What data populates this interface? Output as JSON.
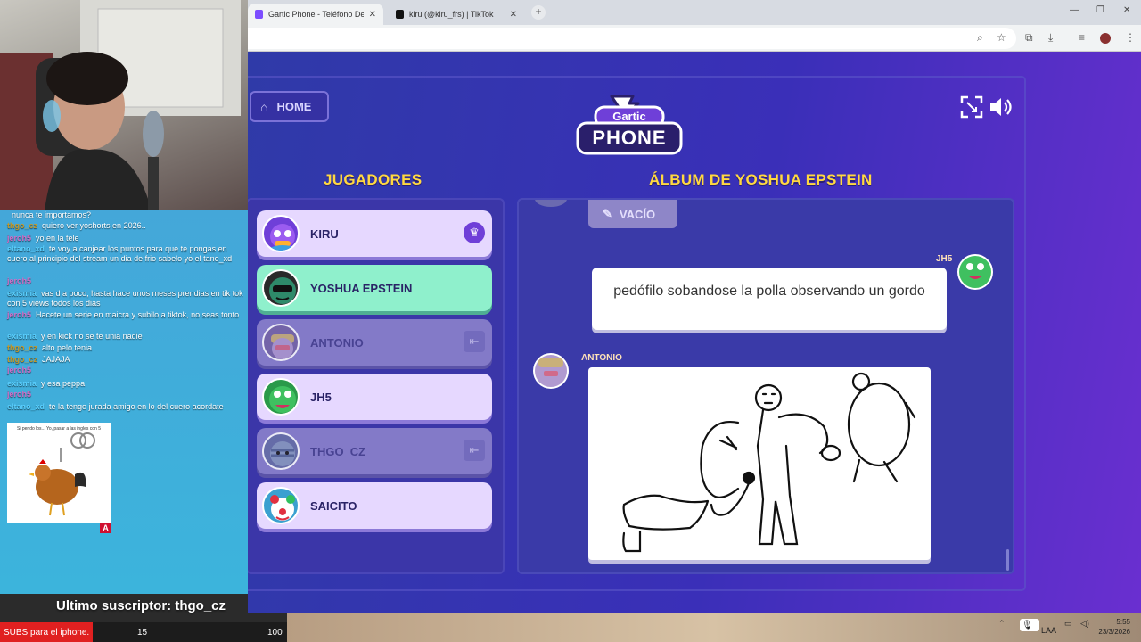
{
  "browser": {
    "tabs": [
      {
        "title": "Gartic Phone - Teléfono Descon",
        "active": true
      },
      {
        "title": "kiru (@kiru_frs) | TikTok",
        "active": false
      }
    ],
    "new_tab": "+"
  },
  "game": {
    "home_label": "HOME",
    "logo_top": "Gartic",
    "logo_bottom": "PHONE",
    "players_title": "JUGADORES",
    "album_title": "ÁLBUM DE YOSHUA EPSTEIN",
    "players": [
      {
        "name": "KIRU",
        "status": "host"
      },
      {
        "name": "YOSHUA EPSTEIN",
        "status": "current"
      },
      {
        "name": "ANTONIO",
        "status": "left"
      },
      {
        "name": "JH5",
        "status": "normal"
      },
      {
        "name": "THGO_CZ",
        "status": "left"
      },
      {
        "name": "SAICITO",
        "status": "normal"
      }
    ],
    "album": {
      "empty_label": "VACÍO",
      "entries": [
        {
          "author": "JH5",
          "type": "text",
          "text": "pedófilo sobandose la polla observando un gordo"
        },
        {
          "author": "ANTONIO",
          "type": "drawing"
        }
      ]
    }
  },
  "stream": {
    "chat": [
      {
        "user": "",
        "text": "nunca te importamos?"
      },
      {
        "user": "thgo_cz",
        "text": "quiero ver yoshorts en 2026.."
      },
      {
        "user": "jeroh5",
        "text": "yo en la tele"
      },
      {
        "user": "eltano_xd",
        "text": "te voy a canjear los puntos para que te pongas en cuero al principio del stream un dia de frio sabelo yo el tano_xd"
      },
      {
        "user": "jeroh5",
        "text": ""
      },
      {
        "user": "exismia",
        "text": "vas d a poco, hasta hace unos meses prendias en tik tok con 5 views todos los dias"
      },
      {
        "user": "jeroh5",
        "text": "Hacete un serie en maicra y subilo a tiktok, no seas tonto"
      },
      {
        "user": "exismia",
        "text": "y en kick no se te unia nadie"
      },
      {
        "user": "thgo_cz",
        "text": "alto pelo tenia"
      },
      {
        "user": "thgo_cz",
        "text": "JAJAJA"
      },
      {
        "user": "jeroh5",
        "text": ""
      },
      {
        "user": "exismia",
        "text": "y esa peppa"
      },
      {
        "user": "jeroh5",
        "text": ""
      },
      {
        "user": "eltano_xd",
        "text": "te la tengo jurada amigo en lo del cuero acordate"
      }
    ],
    "sticker_caption": "Si pendo los... Yo, pasar a las ingles con 5",
    "sticker_badge": "A",
    "last_sub": "Ultimo suscriptor: thgo_cz",
    "ticker_label": "SUBS para el iphone.",
    "ticker_current": "15",
    "ticker_goal": "100"
  },
  "taskbar": {
    "lang": "LAA",
    "time": "5:55",
    "date": "23/3/2026"
  },
  "colors": {
    "accent_title": "#ffd840",
    "game_bg_left": "#2f3aa8",
    "game_bg_right": "#6a2fd0",
    "player_card": "#e6d8ff",
    "player_current": "#8ff0cc"
  }
}
